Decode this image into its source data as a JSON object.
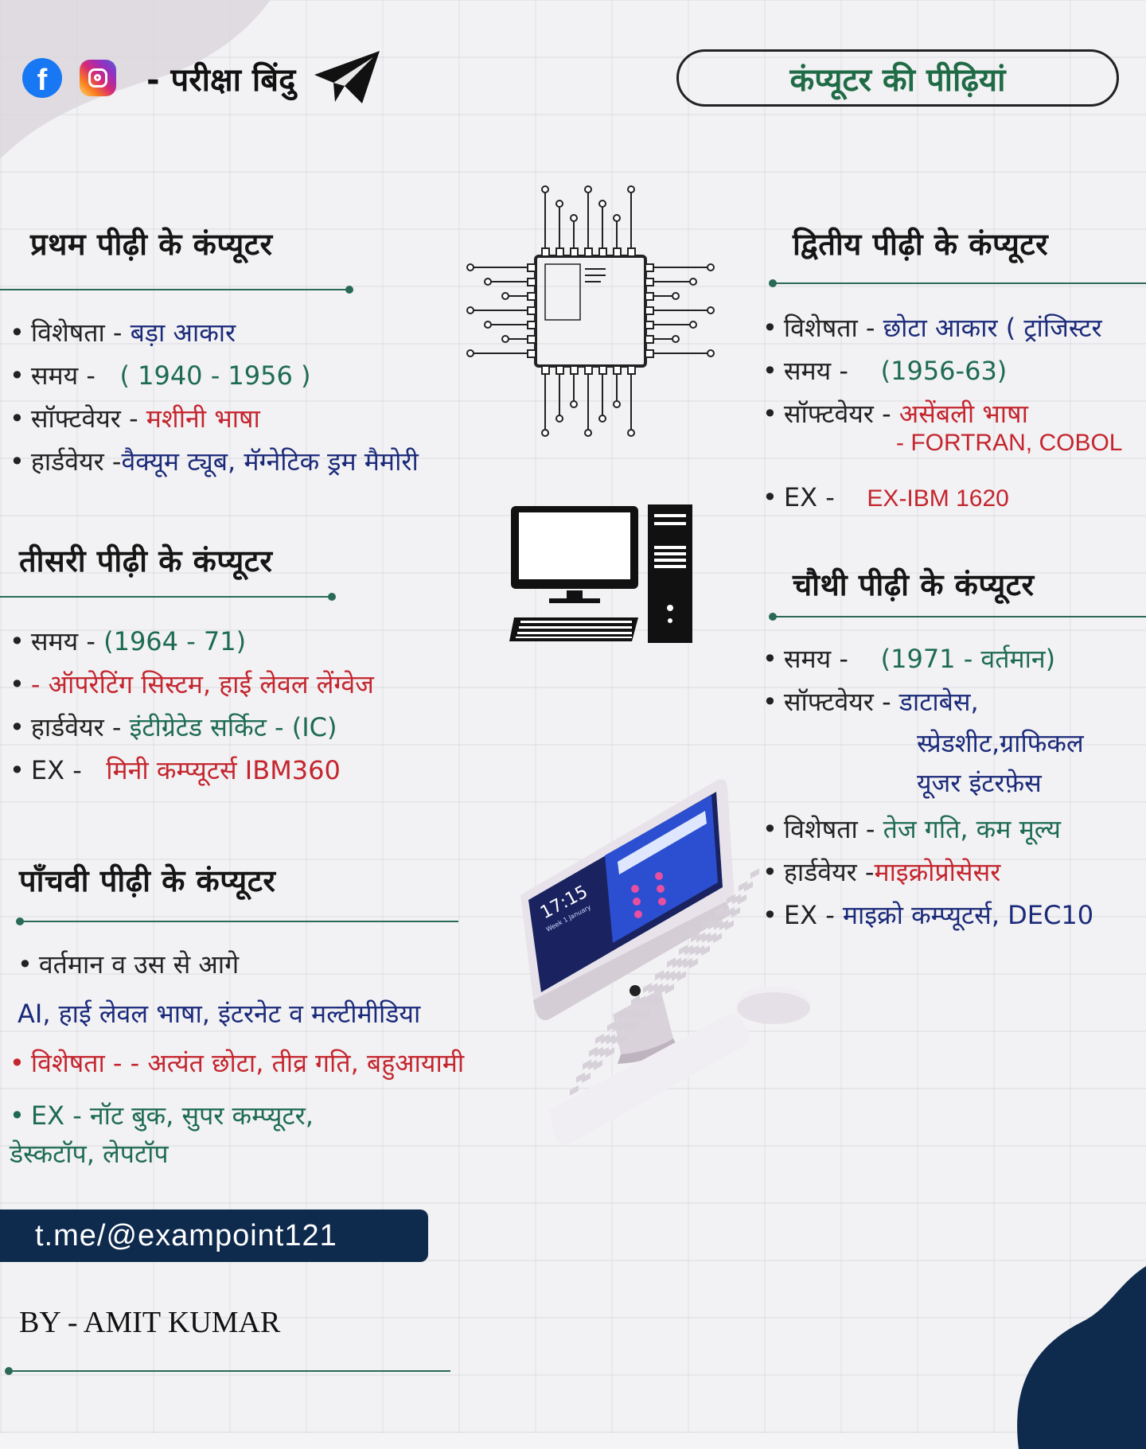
{
  "brand": {
    "name": "- परीक्षा बिंदु",
    "icons": [
      "facebook-icon",
      "instagram-icon",
      "telegram-icon"
    ]
  },
  "title": "कंप्यूटर की पीढ़ियां",
  "gen1": {
    "heading": "प्रथम पीढ़ी के कंप्यूटर",
    "lines": [
      {
        "label": "विशेषता -",
        "value": "बड़ा आकार"
      },
      {
        "label": "समय -",
        "value": "( 1940 - 1956 )"
      },
      {
        "label": "सॉफ्टवेयर -",
        "value": "मशीनी भाषा"
      },
      {
        "label": "हार्डवेयर -",
        "value": "वैक्यूम ट्यूब, मॅग्नेटिक ड्रम मैमोरी"
      }
    ]
  },
  "gen2": {
    "heading": "द्वितीय पीढ़ी के कंप्यूटर",
    "lines": [
      {
        "label": "विशेषता -",
        "value": "छोटा आकार ( ट्रांजिस्टर"
      },
      {
        "label": "समय -",
        "value": "(1956-63)"
      },
      {
        "label": "सॉफ्टवेयर -",
        "value": "असेंबली भाषा"
      },
      {
        "label": "",
        "value": "- FORTRAN, COBOL"
      },
      {
        "label": "EX -",
        "value": "EX-IBM 1620"
      }
    ]
  },
  "gen3": {
    "heading": "तीसरी पीढ़ी के कंप्यूटर",
    "lines": [
      {
        "label": "समय -",
        "value": "(1964 - 71)"
      },
      {
        "label": "",
        "value": "- ऑपरेटिंग सिस्टम, हाई लेवल लेंग्वेज"
      },
      {
        "label": "हार्डवेयर -",
        "value": "इंटीग्रेटेड सर्किट - (IC)"
      },
      {
        "label": "EX -",
        "value": "मिनी कम्प्यूटर्स IBM360"
      }
    ]
  },
  "gen4": {
    "heading": "चौथी पीढ़ी के कंप्यूटर",
    "lines": [
      {
        "label": "समय -",
        "value": "(1971 - वर्तमान)"
      },
      {
        "label": "सॉफ्टवेयर -",
        "value": "डाटाबेस,"
      },
      {
        "label": "",
        "value": "स्प्रेडशीट,ग्राफिकल"
      },
      {
        "label": "",
        "value": "यूजर इंटरफ़ेस"
      },
      {
        "label": "विशेषता -",
        "value": "तेज गति, कम मूल्य"
      },
      {
        "label": "हार्डवेयर -",
        "value": "माइक्रोप्रोसेसर"
      },
      {
        "label": "EX -",
        "value": "माइक्रो कम्प्यूटर्स, DEC10"
      }
    ]
  },
  "gen5": {
    "heading": "पाँचवी पीढ़ी के कंप्यूटर",
    "lines": [
      {
        "value": "वर्तमान व उस से आगे"
      },
      {
        "value": "AI, हाई लेवल भाषा, इंटरनेट व मल्टीमीडिया"
      },
      {
        "label": "विशेषता -",
        "value": "- अत्यंत छोटा, तीव्र गति, बहुआयामी"
      },
      {
        "label": "EX -",
        "value": "नॉट बुक, सुपर कम्प्यूटर,"
      },
      {
        "value": "डेस्कटॉप, लेपटॉप"
      }
    ]
  },
  "imac_screen": {
    "time": "17:15",
    "date": "Week 1 January"
  },
  "telegram": "t.me/@exampoint121",
  "author": "BY -  AMIT KUMAR",
  "colors": {
    "navy": "#0e2a4d",
    "green": "#1d6b52",
    "red": "#c4252e",
    "title_green": "#1e6b45"
  }
}
